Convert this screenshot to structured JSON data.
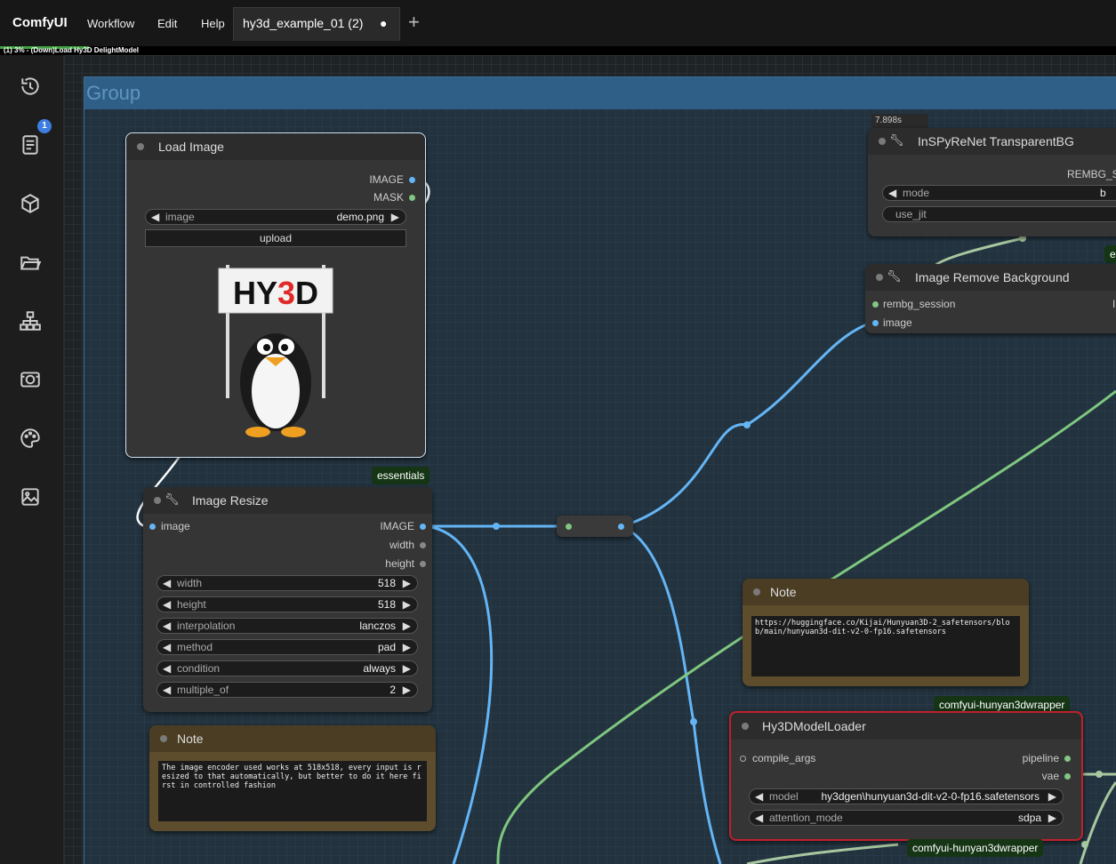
{
  "app": {
    "brand": "ComfyUI",
    "menu": [
      "Workflow",
      "Edit",
      "Help"
    ],
    "tab_label": "hy3d_example_01 (2)",
    "tab_dot": "●",
    "tab_add": "+"
  },
  "progress": {
    "text": "(1) 3% - (Down)Load Hy3D DelightModel",
    "fraction": 0.03
  },
  "sidebar": {
    "queue_count": "1",
    "icons": [
      "history-icon",
      "book-icon",
      "cube-icon",
      "folder-icon",
      "hierarchy-icon",
      "camera-icon",
      "palette-icon",
      "image-icon"
    ]
  },
  "group": {
    "title": "Group"
  },
  "load_image": {
    "title": "Load Image",
    "out_image": "IMAGE",
    "out_mask": "MASK",
    "widget_name": "image",
    "widget_value": "demo.png",
    "upload": "upload",
    "preview_sign": "HY3D"
  },
  "essentials_badge": "essentials",
  "image_resize": {
    "title": "Image Resize",
    "in_image": "image",
    "out_image": "IMAGE",
    "out_width": "width",
    "out_height": "height",
    "widgets": [
      {
        "name": "width",
        "value": "518"
      },
      {
        "name": "height",
        "value": "518"
      },
      {
        "name": "interpolation",
        "value": "lanczos"
      },
      {
        "name": "method",
        "value": "pad"
      },
      {
        "name": "condition",
        "value": "always"
      },
      {
        "name": "multiple_of",
        "value": "2"
      }
    ]
  },
  "note_left": {
    "title": "Note",
    "text": "The image encoder used works at 518x518, every input is resized to that automatically, but better to do it here first in controlled fashion"
  },
  "note_right": {
    "title": "Note",
    "text": "https://huggingface.co/Kijai/Hunyuan3D-2_safetensors/blob/main/hunyuan3d-dit-v2-0-fp16.safetensors"
  },
  "inspyrenet": {
    "time": "7.898s",
    "title": "InSPyReNet TransparentBG",
    "out": "REMBG_S",
    "mode_name": "mode",
    "mode_value": "b",
    "use_jit": "use_jit",
    "right_badge": "e"
  },
  "remove_bg": {
    "title": "Image Remove Background",
    "in_session": "rembg_session",
    "in_image": "image",
    "out_partial": "I"
  },
  "model_loader": {
    "badge_top": "comfyui-hunyan3dwrapper",
    "badge_bottom": "comfyui-hunyan3dwrapper",
    "title": "Hy3DModelLoader",
    "in_compile": "compile_args",
    "out_pipeline": "pipeline",
    "out_vae": "vae",
    "model_name": "model",
    "model_value": "hy3dgen\\hunyuan3d-dit-v2-0-fp16.safetensors",
    "attn_name": "attention_mode",
    "attn_value": "sdpa"
  },
  "colors": {
    "image_port": "#64b5f6",
    "mask_port": "#81c784",
    "model_border": "#c0202a",
    "badge_bg": "#153515"
  }
}
